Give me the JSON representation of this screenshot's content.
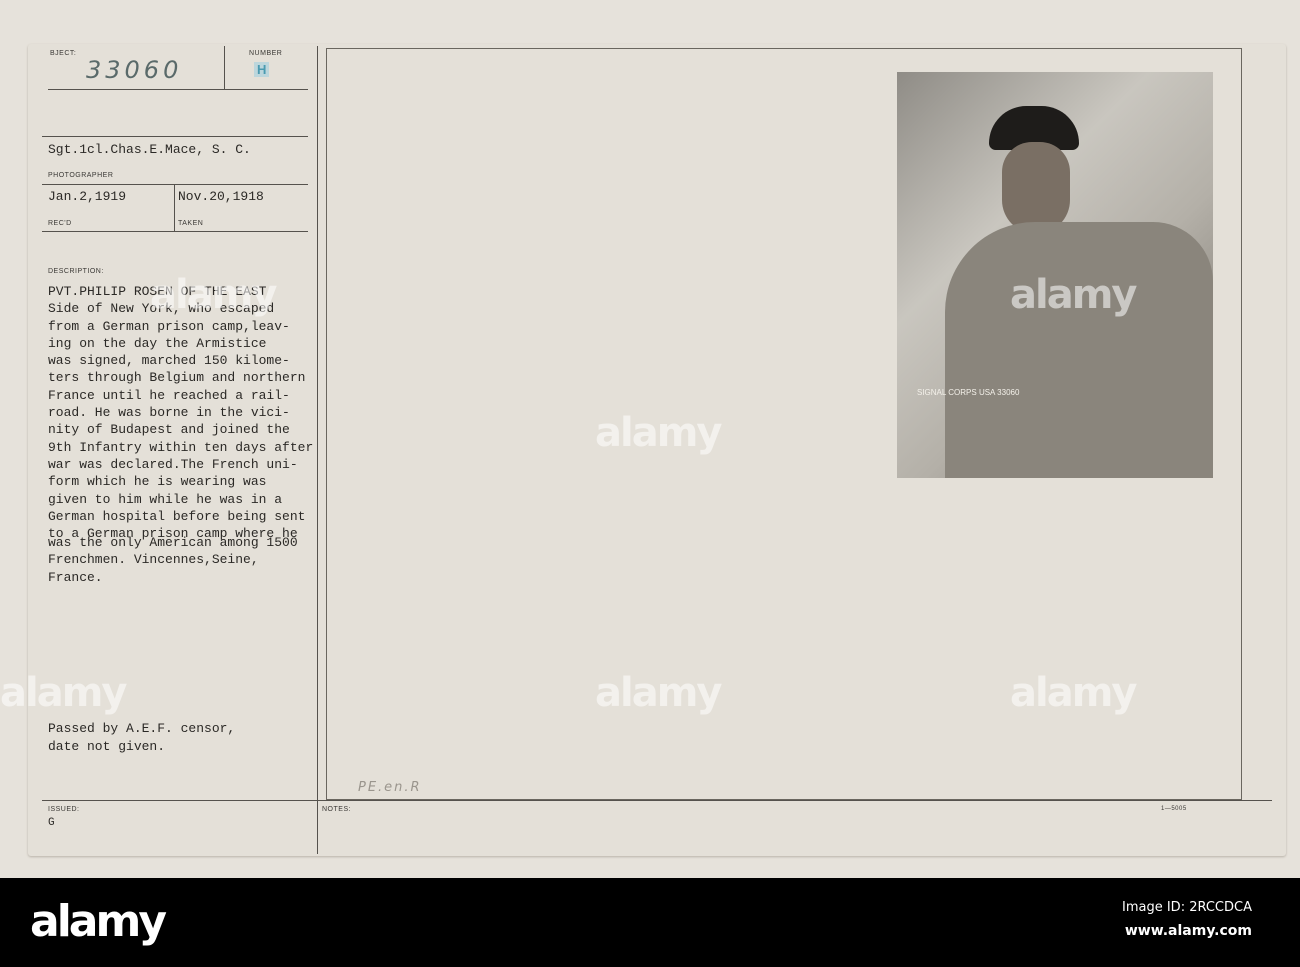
{
  "card": {
    "subject_label": "BJECT:",
    "subject_number": "33060",
    "number_label": "NUMBER",
    "number_stamp": "H",
    "photographer": "Sgt.1cl.Chas.E.Mace, S. C.",
    "photographer_label": "PHOTOGRAPHER",
    "received": "Jan.2,1919",
    "received_label": "REC'D",
    "taken": "Nov.20,1918",
    "taken_label": "TAKEN",
    "description_label": "DESCRIPTION:",
    "description_lines": [
      "PVT.PHILIP ROSEN OF THE EAST",
      "Side of New York, who escaped",
      "from a German prison camp,leav-",
      "ing on the day the Armistice",
      "was signed, marched 150 kilome-",
      "ters through Belgium and northern",
      "France until he reached a rail-",
      "road. He was borne in the vici-",
      "nity of Budapest and joined the",
      "9th Infantry within ten days after",
      "war was declared.The French uni-",
      "form which he is wearing was",
      "given to him while he was in a",
      "German hospital before being sent",
      "to a German prison camp where he",
      "was the only American among 1500",
      "Frenchmen. Vincennes,Seine,",
      "France."
    ],
    "censor_lines": [
      "Passed by A.E.F. censor,",
      "date not given."
    ],
    "issued_label": "ISSUED:",
    "issued": "G",
    "notes_label": "NOTES:",
    "handwritten_note": "PE.en.R",
    "form_number": "1—5005",
    "photo_stamp": "SIGNAL CORPS USA 33060"
  },
  "watermark": {
    "text": "alamy",
    "image_id": "Image ID: 2RCCDCA",
    "url": "www.alamy.com"
  }
}
